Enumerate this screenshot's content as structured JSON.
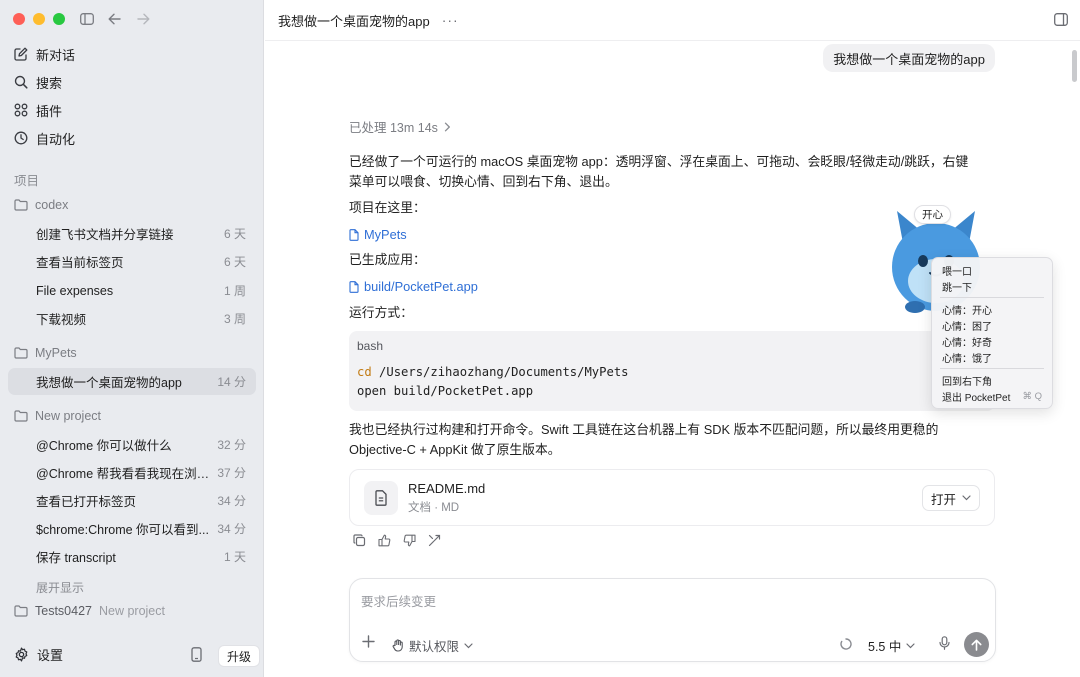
{
  "sidebar": {
    "nav": [
      {
        "label": "新对话",
        "icon": "compose-icon"
      },
      {
        "label": "搜索",
        "icon": "search-icon"
      },
      {
        "label": "插件",
        "icon": "grid-icon"
      },
      {
        "label": "自动化",
        "icon": "clock-icon"
      }
    ],
    "section_label": "项目",
    "projects": [
      {
        "name": "codex",
        "threads": [
          {
            "title": "创建飞书文档并分享链接",
            "time": "6 天"
          },
          {
            "title": "查看当前标签页",
            "time": "6 天"
          },
          {
            "title": "File expenses",
            "time": "1 周"
          },
          {
            "title": "下载视频",
            "time": "3 周"
          }
        ]
      },
      {
        "name": "MyPets",
        "threads": [
          {
            "title": "我想做一个桌面宠物的app",
            "time": "14 分"
          }
        ]
      },
      {
        "name": "New project",
        "threads": [
          {
            "title": "@Chrome 你可以做什么",
            "time": "32 分"
          },
          {
            "title": "@Chrome 帮我看看我现在浏览...",
            "time": "37 分"
          },
          {
            "title": "查看已打开标签页",
            "time": "34 分"
          },
          {
            "title": "$chrome:Chrome 你可以看到...",
            "time": "34 分"
          },
          {
            "title": "保存 transcript",
            "time": "1 天"
          }
        ]
      }
    ],
    "show_more": "展开显示",
    "tests_project": {
      "name": "Tests0427",
      "sub": "New project"
    },
    "settings_label": "设置",
    "upgrade_label": "升级"
  },
  "main": {
    "title": "我想做一个桌面宠物的app",
    "more": "···",
    "user_message": "我想做一个桌面宠物的app",
    "processed": "已处理 13m 14s",
    "paragraph1": "已经做了一个可运行的 macOS 桌面宠物 app：透明浮窗、浮在桌面上、可拖动、会眨眼/轻微走动/跳跃，右键菜单可以喂食、切换心情、回到右下角、退出。",
    "project_here": "项目在这里：",
    "project_link": "MyPets",
    "built_app": "已生成应用：",
    "app_link": "build/PocketPet.app",
    "run_method": "运行方式：",
    "code": {
      "lang": "bash",
      "line1_kw": "cd",
      "line1_rest": " /Users/zihaozhang/Documents/MyPets",
      "line2": "open build/PocketPet.app"
    },
    "paragraph2": "我也已经执行过构建和打开命令。Swift 工具链在这台机器上有 SDK 版本不匹配问题，所以最终用更稳的 Objective-C + AppKit 做了原生版本。",
    "file_card": {
      "name": "README.md",
      "meta": "文档 · MD",
      "open": "打开"
    },
    "pet": {
      "bubble": "开心",
      "menu": [
        {
          "label": "喂一口"
        },
        {
          "label": "跳一下"
        },
        {
          "sep": true
        },
        {
          "label": "心情：开心"
        },
        {
          "label": "心情：困了"
        },
        {
          "label": "心情：好奇"
        },
        {
          "label": "心情：饿了"
        },
        {
          "sep": true
        },
        {
          "label": "回到右下角"
        },
        {
          "label": "退出 PocketPet",
          "shortcut": "⌘ Q"
        }
      ]
    },
    "composer": {
      "placeholder": "要求后续变更",
      "permission": "默认权限",
      "model": "5.5 中"
    }
  },
  "colors": {
    "sidebar_bg": "#e9ebef",
    "link": "#2f6fd6",
    "code_keyword": "#c27b13",
    "send_button": "#8a8b8f"
  }
}
